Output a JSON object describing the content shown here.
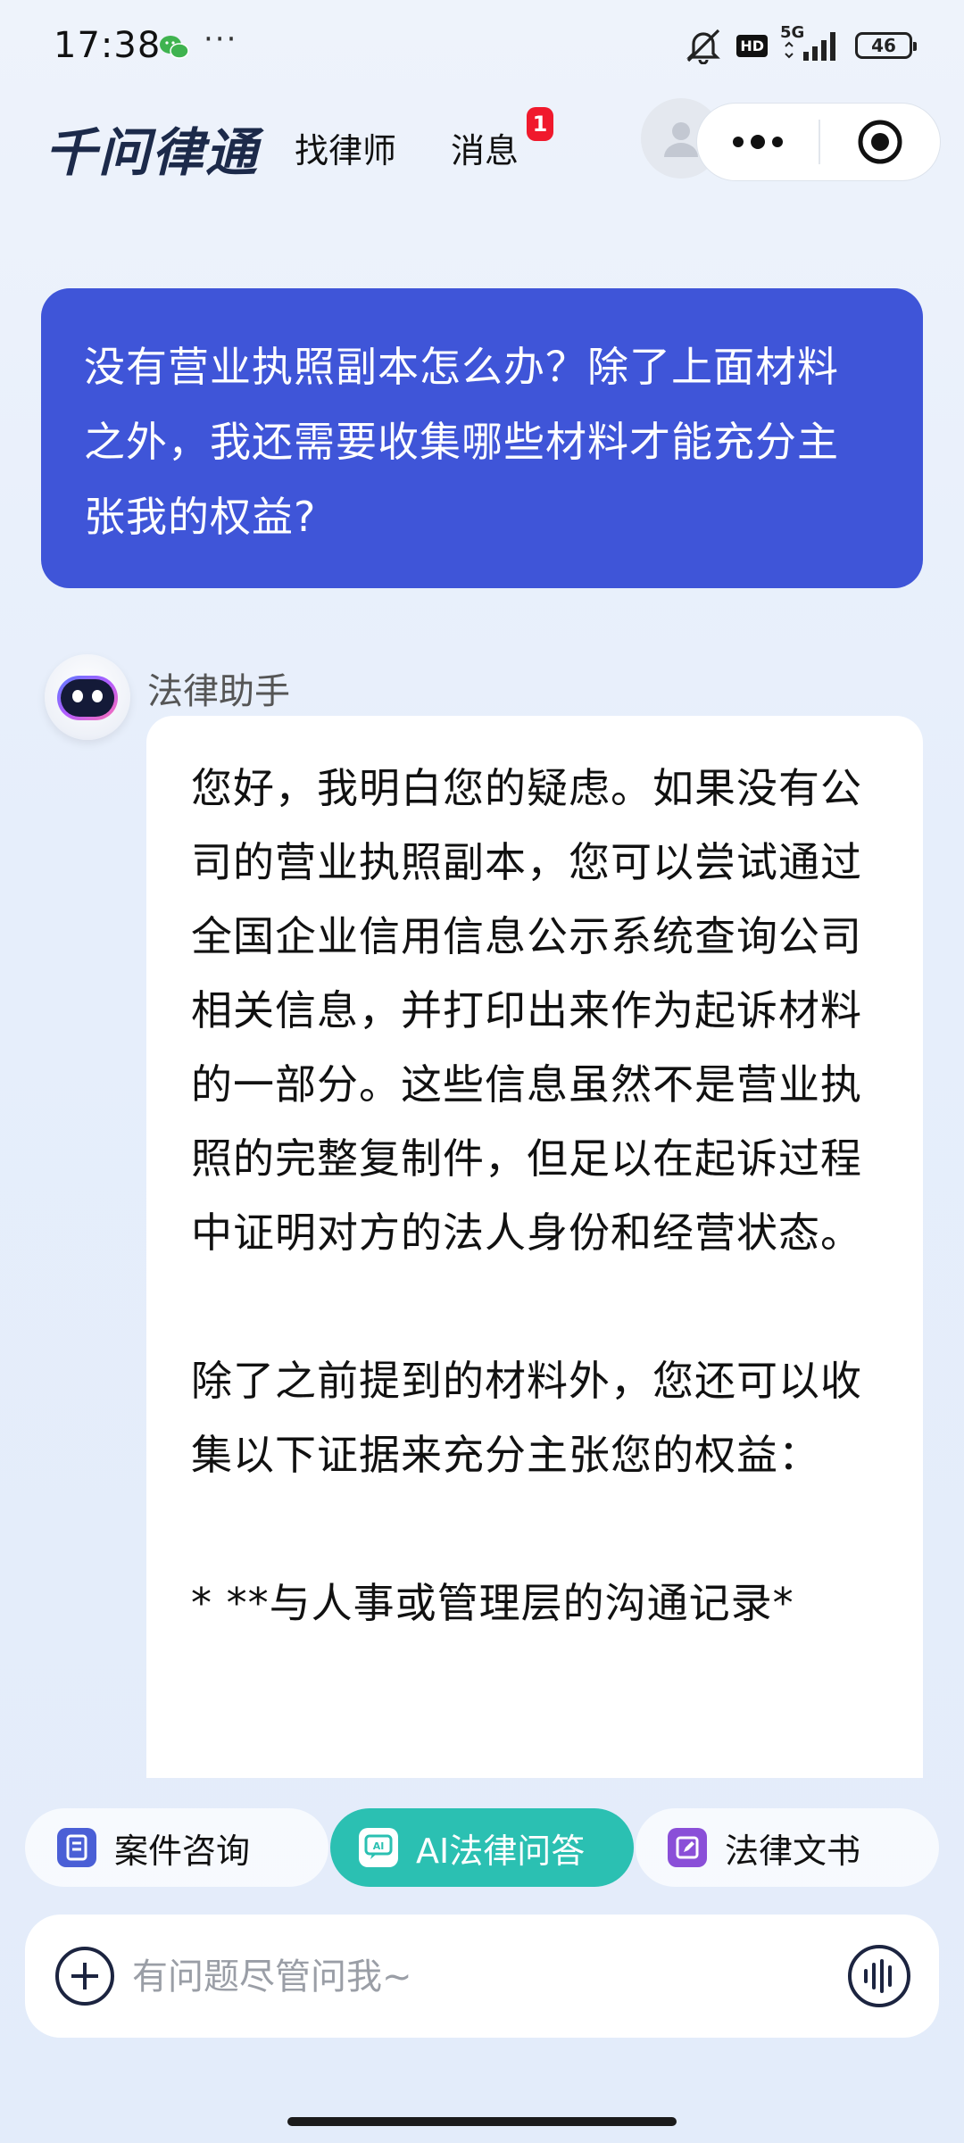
{
  "status_bar": {
    "time": "17:38",
    "more": "···",
    "network": "5G",
    "hd": "HD",
    "battery": "46"
  },
  "header": {
    "logo": "千问律通",
    "nav_lawyer": "找律师",
    "nav_messages": "消息",
    "messages_badge": "1"
  },
  "chat": {
    "user_message": "没有营业执照副本怎么办？除了上面材料之外，我还需要收集哪些材料才能充分主张我的权益?",
    "assistant_name": "法律助手",
    "assistant_paragraphs": [
      "您好，我明白您的疑虑。如果没有公司的营业执照副本，您可以尝试通过全国企业信用信息公示系统查询公司相关信息，并打印出来作为起诉材料的一部分。这些信息虽然不是营业执照的完整复制件，但足以在起诉过程中证明对方的法人身份和经营状态。",
      "除了之前提到的材料外，您还可以收集以下证据来充分主张您的权益：",
      "* **与人事或管理层的沟通记录*"
    ]
  },
  "quick_tabs": {
    "case": "案件咨询",
    "ai": "AI法律问答",
    "doc": "法律文书"
  },
  "input": {
    "placeholder": "有问题尽管问我~"
  },
  "colors": {
    "user_bubble": "#3f55d8",
    "ai_tab": "#2bc0b2",
    "badge": "#f0192c",
    "case_icon": "#4a5fd6",
    "doc_icon": "#8a4fd8"
  }
}
